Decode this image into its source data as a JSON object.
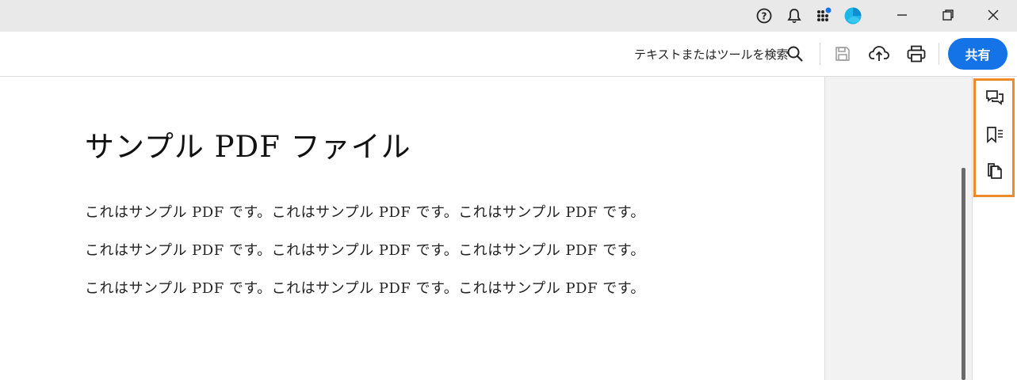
{
  "titlebar": {
    "icons": [
      "help-icon",
      "bell-icon",
      "apps-grid-icon",
      "account-avatar-icon"
    ],
    "window_controls": [
      "minimize-icon",
      "restore-icon",
      "close-icon"
    ]
  },
  "toolbar": {
    "search_label": "テキストまたはツールを検索",
    "share_label": "共有",
    "tools": [
      "save-icon",
      "upload-cloud-icon",
      "print-icon"
    ]
  },
  "document": {
    "title": "サンプル PDF ファイル",
    "lines": [
      "これはサンプル PDF です。これはサンプル PDF です。これはサンプル PDF です。",
      "これはサンプル PDF です。これはサンプル PDF です。これはサンプル PDF です。",
      "これはサンプル PDF です。これはサンプル PDF です。これはサンプル PDF です。"
    ]
  },
  "right_panel": {
    "buttons": [
      "comments-icon",
      "bookmarks-icon",
      "pages-icon"
    ],
    "highlight_color": "#ef8a2b"
  },
  "colors": {
    "accent": "#1473e6"
  }
}
